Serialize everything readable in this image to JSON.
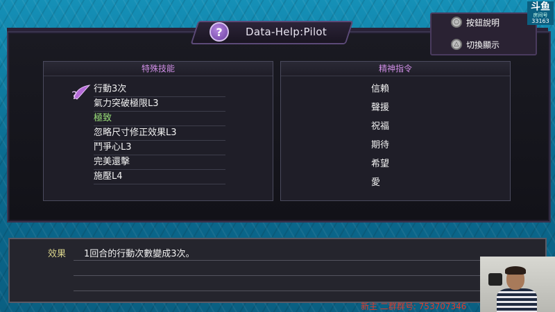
{
  "title": "Data-Help:Pilot",
  "menu": {
    "items": [
      {
        "label": "按鈕說明",
        "button": "circle"
      },
      {
        "label": "切換顯示",
        "button": "triangle"
      }
    ]
  },
  "logo": {
    "title": "斗鱼",
    "sub": "房间号",
    "number": "33163"
  },
  "skills_panel": {
    "header": "特殊技能",
    "items": [
      {
        "label": "行動3次",
        "highlight": false
      },
      {
        "label": "氣力突破極限L3",
        "highlight": false
      },
      {
        "label": "極致",
        "highlight": true
      },
      {
        "label": "忽略尺寸修正效果L3",
        "highlight": false
      },
      {
        "label": "鬥爭心L3",
        "highlight": false
      },
      {
        "label": "完美還擊",
        "highlight": false
      },
      {
        "label": "施壓L4",
        "highlight": false
      }
    ]
  },
  "spirit_panel": {
    "header": "精神指令",
    "items": [
      "信賴",
      "聲援",
      "祝福",
      "期待",
      "希望",
      "愛"
    ]
  },
  "description": {
    "label": "效果",
    "text": "1回合的行動次數變成3次。"
  },
  "overlay": {
    "text": "新主 二群群号: 753707346"
  },
  "colors": {
    "accent_purple": "#d08ee6",
    "highlight_green": "#9be27a",
    "label_yellow": "#d8d28a",
    "background_blue": "#0d6f95"
  }
}
